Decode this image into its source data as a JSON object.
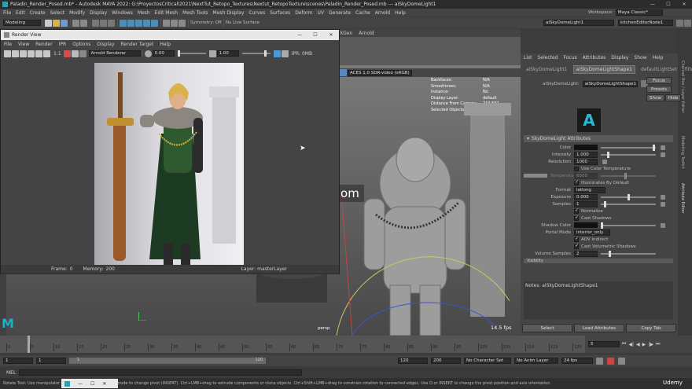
{
  "window": {
    "title": "Paladin_Render_Posed.mb* - Autodesk MAYA 2022: G:\\ProyectosCriticall2021\\NextTut_Retopo_Textures\\Nextut_RetopoTexture\\scenes\\Paladin_Render_Posed.mb --- aiSkyDomeLight1"
  },
  "menubar": [
    "File",
    "Edit",
    "Create",
    "Select",
    "Modify",
    "Display",
    "Windows",
    "Mesh",
    "Edit Mesh",
    "Mesh Tools",
    "Mesh Display",
    "Curves",
    "Surfaces",
    "Deform",
    "UV",
    "Generate",
    "Cache",
    "Arnold",
    "Help"
  ],
  "workspace": {
    "label": "Workspace:",
    "value": "Maya Classic*"
  },
  "statusline": {
    "mode": "Modeling",
    "symmetry": "Symmetry: Off",
    "surface": "No Live Surface",
    "light_field": "aiSkyDomeLight1",
    "shape_field": "kitchenEditorNode1"
  },
  "tab_bar": [
    "XGen",
    "Arnold"
  ],
  "render_view": {
    "title": "Render View",
    "menu": [
      "File",
      "View",
      "Render",
      "IPR",
      "Options",
      "Display",
      "Render Target",
      "Help"
    ],
    "renderer": "Arnold Renderer",
    "ratio": "1:1",
    "value_a": "0.00",
    "value_b": "1.00",
    "ipr_label": "IPR: 0MB",
    "frame_label": "Frame:",
    "frame_value": "0",
    "memory_label": "Memory:",
    "memory_value": "200",
    "layer_label": "Layer: masterLayer"
  },
  "viewport": {
    "color_space": "ACES 1.0 SDR-video (sRGB)",
    "hud": [
      {
        "k": "Backfaces:",
        "v": "N/A"
      },
      {
        "k": "Smoothness:",
        "v": "N/A"
      },
      {
        "k": "Instance:",
        "v": "No"
      },
      {
        "k": "Display Layer:",
        "v": "default"
      },
      {
        "k": "Distance From Camera:",
        "v": "219.602"
      },
      {
        "k": "Selected Objects:",
        "v": "1"
      }
    ],
    "camera": "persp",
    "fps": "14.5 fps"
  },
  "watermark": "Cger.com",
  "side_tabs": [
    "Channel Box / Layer Editor",
    "Modelling Toolkit",
    "Attribute Editor"
  ],
  "attribute_editor": {
    "menu": [
      "List",
      "Selected",
      "Focus",
      "Attributes",
      "Display",
      "Show",
      "Help"
    ],
    "tabs": [
      "aiSkyDomeLight1",
      "aiSkyDomeLightShape1",
      "defaultLightSet",
      "filte4"
    ],
    "node_label": "aiSkyDomeLight:",
    "node_value": "aiSkyDomeLightShape1",
    "focus_btn": "Focus",
    "presets_btn": "Presets",
    "show_btn": "Show",
    "hide_btn": "Hide",
    "section": "SkyDomeLight Attributes",
    "attrs": [
      {
        "label": "Color",
        "value": ""
      },
      {
        "label": "Intensity",
        "value": "1.000"
      },
      {
        "label": "Resolution",
        "value": "1000"
      }
    ],
    "use_temp": "Use Color Temperature",
    "temp_label": "Temperature",
    "temp_value": "6500",
    "illum_default": "Illuminates By Default",
    "format_label": "Format",
    "format_value": "latlong",
    "exposure_label": "Exposure",
    "exposure_value": "0.000",
    "samples_label": "Samples",
    "samples_value": "1",
    "normalize": "Normalize",
    "cast_shadows": "Cast Shadows",
    "shadow_color_label": "Shadow Color",
    "portal_label": "Portal Mode",
    "portal_value": "interior_only",
    "aov_indirect": "AOV Indirect",
    "cast_vol_shadows": "Cast Volumetric Shadows",
    "vol_samples_label": "Volume Samples",
    "vol_samples_value": "2",
    "visibility": "Visibility",
    "notes": "Notes: aiSkyDomeLightShape1",
    "select_btn": "Select",
    "load_btn": "Load Attributes",
    "copy_btn": "Copy Tab"
  },
  "timeline": {
    "ticks": [
      "0",
      "5",
      "10",
      "15",
      "20",
      "25",
      "30",
      "35",
      "40",
      "45",
      "50",
      "55",
      "60",
      "65",
      "70",
      "75",
      "80",
      "85",
      "90",
      "95",
      "100",
      "105",
      "110",
      "115",
      "120"
    ],
    "current_frame": "5"
  },
  "range": {
    "start": "1",
    "inner_start": "1",
    "slider_val": "1",
    "slider_end": "120",
    "end": "120",
    "outer_end": "200",
    "char_set": "No Character Set",
    "anim_layer": "No Anim Layer",
    "fps": "24 fps"
  },
  "cmdline": {
    "label": "MEL"
  },
  "helpline": "Rotate Tool: Use manipulator to rotate object(s). Use edit mode to change pivot (INSERT). Ctrl+LMB+drag to extrude components or clone objects. Ctrl+Shift+LMB+drag to constrain rotation to connected edges. Use D or INSERT to change the pivot position and axis orientation.",
  "udemy": "Udemy"
}
